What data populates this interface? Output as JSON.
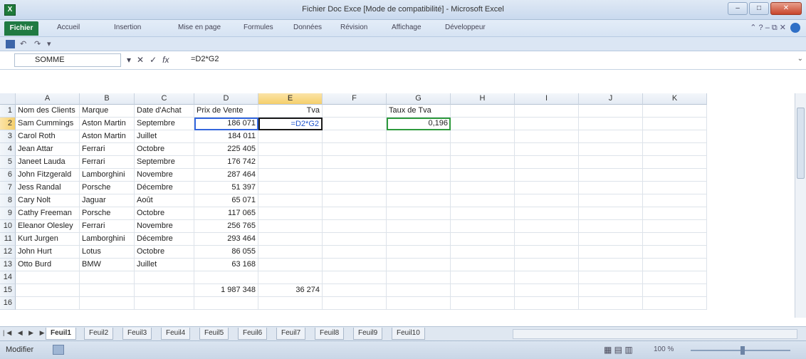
{
  "window": {
    "title": "Fichier Doc Exce [Mode de compatibilité] - Microsoft Excel",
    "app_icon_letter": "X",
    "buttons": {
      "minimize": "–",
      "maximize": "□",
      "close": "✕"
    }
  },
  "ribbon": {
    "tabs": [
      "Fichier",
      "Accueil",
      "Insertion",
      "Mise en page",
      "Formules",
      "Données",
      "Révision",
      "Affichage",
      "Développeur"
    ],
    "right_icons": "⌃ ? – ⧉ ✕"
  },
  "qat": {
    "undo": "↶",
    "redo": "↷",
    "dropdown": "▾"
  },
  "formula_bar": {
    "name_box": "SOMME",
    "cancel": "✕",
    "enter": "✓",
    "fx": "fx",
    "formula": "=D2*G2"
  },
  "columns": [
    "A",
    "B",
    "C",
    "D",
    "E",
    "F",
    "G",
    "H",
    "I",
    "J",
    "K"
  ],
  "rows": [
    [
      "Nom des Clients",
      "Marque",
      "Date d'Achat",
      "Prix de Vente",
      "Tva",
      "",
      "Taux de Tva"
    ],
    [
      "Sam Cummings",
      "Aston Martin",
      "Septembre",
      "186 071",
      "=D2*G2",
      "",
      "0,196"
    ],
    [
      "Carol Roth",
      "Aston Martin",
      "Juillet",
      "184 011",
      "",
      "",
      ""
    ],
    [
      "Jean Attar",
      "Ferrari",
      "Octobre",
      "225 405",
      "",
      "",
      ""
    ],
    [
      "Janeet Lauda",
      "Ferrari",
      "Septembre",
      "176 742",
      "",
      "",
      ""
    ],
    [
      "John Fitzgerald",
      "Lamborghini",
      "Novembre",
      "287 464",
      "",
      "",
      ""
    ],
    [
      "Jess Randal",
      "Porsche",
      "Décembre",
      "51 397",
      "",
      "",
      ""
    ],
    [
      "Cary Nolt",
      "Jaguar",
      "Août",
      "65 071",
      "",
      "",
      ""
    ],
    [
      "Cathy Freeman",
      "Porsche",
      "Octobre",
      "117 065",
      "",
      "",
      ""
    ],
    [
      "Eleanor Olesley",
      "Ferrari",
      "Novembre",
      "256 765",
      "",
      "",
      ""
    ],
    [
      "Kurt Jurgen",
      "Lamborghini",
      "Décembre",
      "293 464",
      "",
      "",
      ""
    ],
    [
      "John Hurt",
      "Lotus",
      "Octobre",
      "86 055",
      "",
      "",
      ""
    ],
    [
      "Otto Burd",
      "BMW",
      "Juillet",
      "63 168",
      "",
      "",
      ""
    ],
    [
      "",
      "",
      "",
      "",
      "",
      "",
      ""
    ],
    [
      "",
      "",
      "",
      "1 987 348",
      "36 274",
      "",
      ""
    ],
    [
      "",
      "",
      "",
      "",
      "",
      "",
      ""
    ]
  ],
  "sheets": [
    "Feuil1",
    "Feuil2",
    "Feuil3",
    "Feuil4",
    "Feuil5",
    "Feuil6",
    "Feuil7",
    "Feuil8",
    "Feuil9",
    "Feuil10"
  ],
  "active_sheet": "Feuil1",
  "status": {
    "mode": "Modifier",
    "zoom": "100 %"
  }
}
